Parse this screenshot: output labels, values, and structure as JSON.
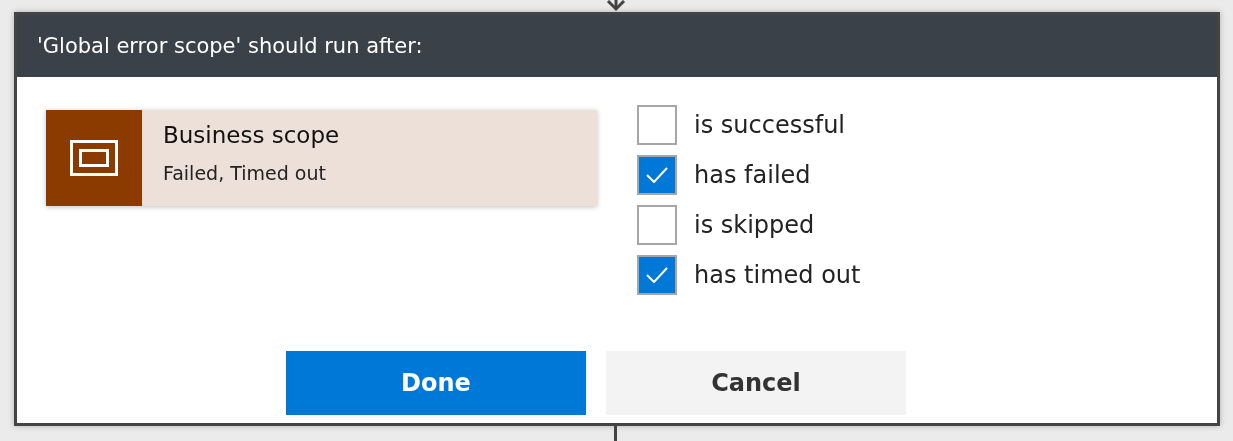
{
  "dialog": {
    "title": "'Global error scope' should run after:",
    "action_card": {
      "name": "Business scope",
      "statuses": "Failed, Timed out"
    },
    "options": [
      {
        "label": "is successful",
        "checked": false
      },
      {
        "label": "has failed",
        "checked": true
      },
      {
        "label": "is skipped",
        "checked": false
      },
      {
        "label": "has timed out",
        "checked": true
      }
    ],
    "buttons": [
      {
        "label": "Done",
        "kind": "primary"
      },
      {
        "label": "Cancel",
        "kind": "secondary"
      }
    ]
  }
}
